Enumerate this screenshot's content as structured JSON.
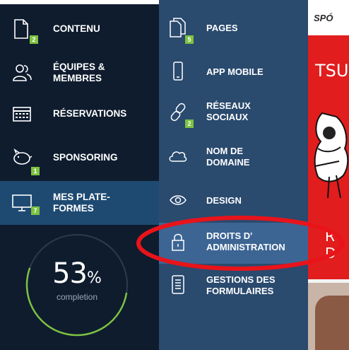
{
  "left_menu": {
    "items": [
      {
        "label": "CONTENU",
        "icon": "document-icon",
        "badge": "2"
      },
      {
        "label": "ÉQUIPES & MEMBRES",
        "icon": "people-icon",
        "badge": ""
      },
      {
        "label": "RÉSERVATIONS",
        "icon": "calendar-icon",
        "badge": ""
      },
      {
        "label": "SPONSORING",
        "icon": "piggy-bank-icon",
        "badge": "1"
      },
      {
        "label": "MES PLATE-FORMES",
        "icon": "monitor-icon",
        "badge": "7"
      }
    ],
    "active_index": 4
  },
  "progress": {
    "value_text": "53",
    "percent_sign": "%",
    "label": "completion",
    "fraction": 0.53
  },
  "sub_menu": {
    "items": [
      {
        "label": "PAGES",
        "icon": "pages-icon",
        "badge": "5"
      },
      {
        "label": "APP MOBILE",
        "icon": "mobile-phone-icon",
        "badge": ""
      },
      {
        "label": "RÉSEAUX SOCIAUX",
        "icon": "link-chain-icon",
        "badge": "2"
      },
      {
        "label": "NOM DE DOMAINE",
        "icon": "cloud-icon",
        "badge": ""
      },
      {
        "label": "DESIGN",
        "icon": "eye-icon",
        "badge": ""
      },
      {
        "label": "DROITS D' ADMINISTRATION",
        "icon": "lock-icon",
        "badge": ""
      },
      {
        "label": "GESTIONS DES FORMULAIRES",
        "icon": "form-list-icon",
        "badge": ""
      }
    ],
    "highlight_index": 5
  },
  "background": {
    "sponsor_fragment": "SPÓ",
    "tsu_fragment": "TSU",
    "rd_fragment": "R D"
  },
  "colors": {
    "left_bg": "#0f1c2e",
    "active_bg": "#1e4a72",
    "sub_bg": "#2a4a6e",
    "highlight_bg": "#3c6594",
    "badge": "#7cc242",
    "annotation": "#e8141a"
  }
}
